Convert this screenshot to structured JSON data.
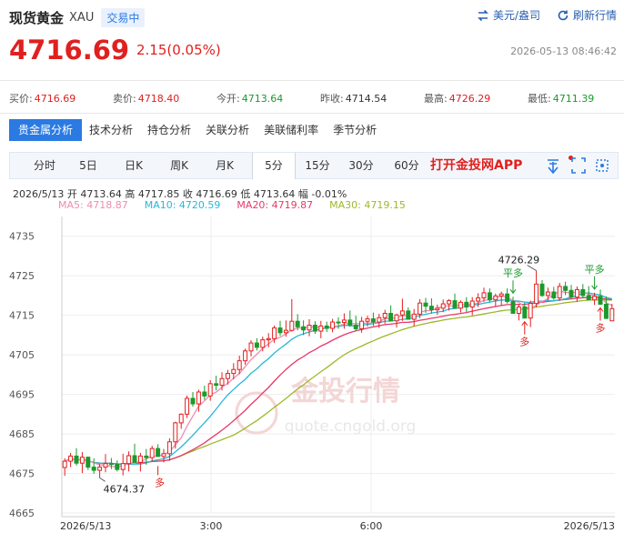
{
  "header": {
    "name": "现货黄金",
    "code": "XAU",
    "status": "交易中",
    "currency_label": "美元/盎司",
    "refresh_label": "刷新行情"
  },
  "price": {
    "last": "4716.69",
    "change": "2.15(0.05%)",
    "time": "2026-05-13 08:46:42"
  },
  "quotes": [
    {
      "label": "买价:",
      "value": "4716.69",
      "color": "red"
    },
    {
      "label": "卖价:",
      "value": "4718.40",
      "color": "red"
    },
    {
      "label": "今开:",
      "value": "4713.64",
      "color": "grn"
    },
    {
      "label": "昨收:",
      "value": "4714.54",
      "color": "blk"
    },
    {
      "label": "最高:",
      "value": "4726.29",
      "color": "red"
    },
    {
      "label": "最低:",
      "value": "4711.39",
      "color": "grn"
    }
  ],
  "tabs": [
    "贵金属分析",
    "技术分析",
    "持仓分析",
    "关联分析",
    "美联储利率",
    "季节分析"
  ],
  "periods": [
    "分时",
    "5日",
    "日K",
    "周K",
    "月K",
    "5分",
    "15分",
    "30分",
    "60分"
  ],
  "active_period": "5分",
  "app_link": "打开金投网APP",
  "toolbar_icons": [
    "draw-icon",
    "fullscreen-icon",
    "settings-icon"
  ],
  "ohlc_info": {
    "date": "2026/5/13",
    "open_label": "开",
    "open": "4713.64",
    "high_label": "高",
    "high": "4717.85",
    "close_label": "收",
    "close": "4716.69",
    "low_label": "低",
    "low": "4713.64",
    "amp_label": "幅",
    "amp": "-0.01%"
  },
  "ma_info": [
    {
      "label": "MA5: 4718.87",
      "color": "#f08cb0"
    },
    {
      "label": "MA10: 4720.59",
      "color": "#2ab7d8"
    },
    {
      "label": "MA20: 4719.87",
      "color": "#e8386a"
    },
    {
      "label": "MA30: 4719.15",
      "color": "#9cb92a"
    }
  ],
  "watermark": {
    "brand": "金投行情",
    "url": "quote.cngold.org"
  },
  "chart_data": {
    "type": "candlestick",
    "ylim": [
      4665,
      4740
    ],
    "y_ticks": [
      4735,
      4725,
      4715,
      4705,
      4695,
      4685,
      4675,
      4665
    ],
    "x_ticks": [
      "2026/5/13",
      "3:00",
      "6:00",
      "2026/5/13"
    ],
    "up_color": "#e0201e",
    "down_color": "#1a9a2c",
    "candles": [
      [
        4676.5,
        4678.8,
        4674.4,
        4678.1
      ],
      [
        4678.1,
        4680.2,
        4676.6,
        4679.4
      ],
      [
        4679.4,
        4681.4,
        4677.0,
        4677.6
      ],
      [
        4677.6,
        4680.4,
        4675.1,
        4679.1
      ],
      [
        4679.1,
        4679.3,
        4675.9,
        4676.6
      ],
      [
        4676.6,
        4678.8,
        4674.9,
        4675.8
      ],
      [
        4675.8,
        4677.4,
        4673.9,
        4676.6
      ],
      [
        4676.6,
        4679.9,
        4675.3,
        4677.5
      ],
      [
        4677.5,
        4678.9,
        4676.1,
        4677.4
      ],
      [
        4677.4,
        4678.3,
        4675.5,
        4676.0
      ],
      [
        4676.0,
        4680.0,
        4674.5,
        4677.5
      ],
      [
        4677.5,
        4680.6,
        4675.5,
        4679.5
      ],
      [
        4679.5,
        4682.5,
        4678.0,
        4677.8
      ],
      [
        4677.8,
        4680.2,
        4675.5,
        4679.4
      ],
      [
        4679.4,
        4681.2,
        4677.2,
        4679.0
      ],
      [
        4679.0,
        4682.0,
        4678.0,
        4681.3
      ],
      [
        4681.3,
        4682.4,
        4679.7,
        4679.3
      ],
      [
        4679.3,
        4681.2,
        4677.8,
        4680.0
      ],
      [
        4680.0,
        4683.9,
        4678.2,
        4683.0
      ],
      [
        4683.0,
        4688.1,
        4681.3,
        4687.8
      ],
      [
        4687.8,
        4690.2,
        4686.3,
        4690.0
      ],
      [
        4690.0,
        4694.7,
        4689.0,
        4694.0
      ],
      [
        4694.0,
        4695.6,
        4691.9,
        4692.6
      ],
      [
        4692.6,
        4696.2,
        4690.6,
        4695.6
      ],
      [
        4695.6,
        4697.2,
        4693.6,
        4694.6
      ],
      [
        4694.6,
        4698.6,
        4693.4,
        4697.7
      ],
      [
        4697.7,
        4699.7,
        4696.0,
        4697.3
      ],
      [
        4697.3,
        4700.6,
        4696.0,
        4699.0
      ],
      [
        4699.0,
        4701.2,
        4697.5,
        4700.3
      ],
      [
        4700.3,
        4702.9,
        4698.8,
        4701.3
      ],
      [
        4701.3,
        4704.8,
        4700.1,
        4703.5
      ],
      [
        4703.5,
        4706.6,
        4702.5,
        4706.0
      ],
      [
        4706.0,
        4708.7,
        4704.6,
        4708.0
      ],
      [
        4708.0,
        4709.2,
        4706.1,
        4706.9
      ],
      [
        4706.9,
        4709.6,
        4705.9,
        4708.8
      ],
      [
        4708.8,
        4710.5,
        4706.9,
        4709.1
      ],
      [
        4709.1,
        4712.4,
        4708.0,
        4711.8
      ],
      [
        4711.8,
        4713.6,
        4709.8,
        4710.6
      ],
      [
        4710.6,
        4713.7,
        4709.6,
        4711.2
      ],
      [
        4711.2,
        4719.1,
        4710.9,
        4713.5
      ],
      [
        4713.5,
        4715.3,
        4711.2,
        4712.1
      ],
      [
        4712.1,
        4713.7,
        4710.0,
        4711.3
      ],
      [
        4711.3,
        4714.0,
        4709.7,
        4712.5
      ],
      [
        4712.5,
        4713.5,
        4710.3,
        4711.0
      ],
      [
        4711.0,
        4713.6,
        4709.2,
        4712.3
      ],
      [
        4712.3,
        4713.4,
        4710.8,
        4711.7
      ],
      [
        4711.7,
        4714.1,
        4710.7,
        4713.3
      ],
      [
        4713.3,
        4714.5,
        4711.6,
        4713.2
      ],
      [
        4713.2,
        4715.5,
        4711.6,
        4713.8
      ],
      [
        4713.8,
        4716.2,
        4712.1,
        4712.5
      ],
      [
        4712.5,
        4714.9,
        4711.0,
        4711.6
      ],
      [
        4711.6,
        4714.6,
        4710.6,
        4713.5
      ],
      [
        4713.5,
        4714.9,
        4712.2,
        4714.1
      ],
      [
        4714.1,
        4715.7,
        4712.3,
        4713.3
      ],
      [
        4713.3,
        4715.4,
        4711.8,
        4714.4
      ],
      [
        4714.4,
        4716.4,
        4712.9,
        4715.5
      ],
      [
        4715.5,
        4717.5,
        4713.6,
        4713.6
      ],
      [
        4713.6,
        4715.4,
        4711.9,
        4715.1
      ],
      [
        4715.1,
        4719.2,
        4713.6,
        4716.1
      ],
      [
        4716.1,
        4717.0,
        4714.0,
        4714.0
      ],
      [
        4714.0,
        4716.6,
        4712.2,
        4715.3
      ],
      [
        4715.3,
        4719.1,
        4714.3,
        4718.1
      ],
      [
        4718.1,
        4719.4,
        4715.6,
        4717.3
      ],
      [
        4717.3,
        4719.3,
        4715.4,
        4716.4
      ],
      [
        4716.4,
        4717.7,
        4715.1,
        4716.8
      ],
      [
        4716.8,
        4719.0,
        4715.8,
        4717.9
      ],
      [
        4717.9,
        4719.1,
        4716.2,
        4718.7
      ],
      [
        4718.7,
        4720.5,
        4716.8,
        4716.8
      ],
      [
        4716.8,
        4718.8,
        4715.7,
        4718.3
      ],
      [
        4718.3,
        4719.6,
        4715.8,
        4717.1
      ],
      [
        4717.1,
        4719.6,
        4715.0,
        4718.6
      ],
      [
        4718.6,
        4720.6,
        4717.1,
        4719.4
      ],
      [
        4719.4,
        4722.0,
        4718.4,
        4720.7
      ],
      [
        4720.7,
        4721.8,
        4718.4,
        4718.9
      ],
      [
        4718.9,
        4720.5,
        4717.3,
        4719.9
      ],
      [
        4719.9,
        4721.0,
        4717.5,
        4720.4
      ],
      [
        4720.4,
        4721.8,
        4718.0,
        4718.5
      ],
      [
        4718.5,
        4719.7,
        4715.5,
        4715.5
      ],
      [
        4715.5,
        4717.8,
        4713.7,
        4717.1
      ],
      [
        4717.1,
        4718.2,
        4714.3,
        4714.3
      ],
      [
        4714.3,
        4718.7,
        4712.0,
        4718.0
      ],
      [
        4718.0,
        4726.3,
        4717.0,
        4722.9
      ],
      [
        4722.9,
        4723.9,
        4719.7,
        4720.0
      ],
      [
        4720.0,
        4722.0,
        4718.8,
        4720.9
      ],
      [
        4720.9,
        4722.2,
        4718.9,
        4719.4
      ],
      [
        4719.4,
        4723.2,
        4718.6,
        4722.3
      ],
      [
        4722.3,
        4723.5,
        4720.1,
        4721.3
      ],
      [
        4721.3,
        4722.7,
        4719.2,
        4719.6
      ],
      [
        4719.6,
        4722.3,
        4718.4,
        4721.5
      ],
      [
        4721.5,
        4722.9,
        4719.4,
        4720.0
      ],
      [
        4720.0,
        4722.4,
        4718.8,
        4718.9
      ],
      [
        4718.9,
        4720.7,
        4717.6,
        4719.8
      ],
      [
        4719.8,
        4721.5,
        4717.8,
        4717.8
      ],
      [
        4717.8,
        4719.8,
        4716.5,
        4714.2
      ],
      [
        4713.6,
        4717.9,
        4713.6,
        4716.7
      ]
    ],
    "annotations": [
      {
        "text": "4726.29",
        "type": "high"
      },
      {
        "text": "4674.37",
        "type": "low"
      },
      {
        "text": "平多",
        "type": "signal"
      },
      {
        "text": "平多",
        "type": "signal"
      },
      {
        "text": "多",
        "type": "signal"
      },
      {
        "text": "多",
        "type": "signal"
      },
      {
        "text": "多",
        "type": "signal"
      }
    ]
  }
}
